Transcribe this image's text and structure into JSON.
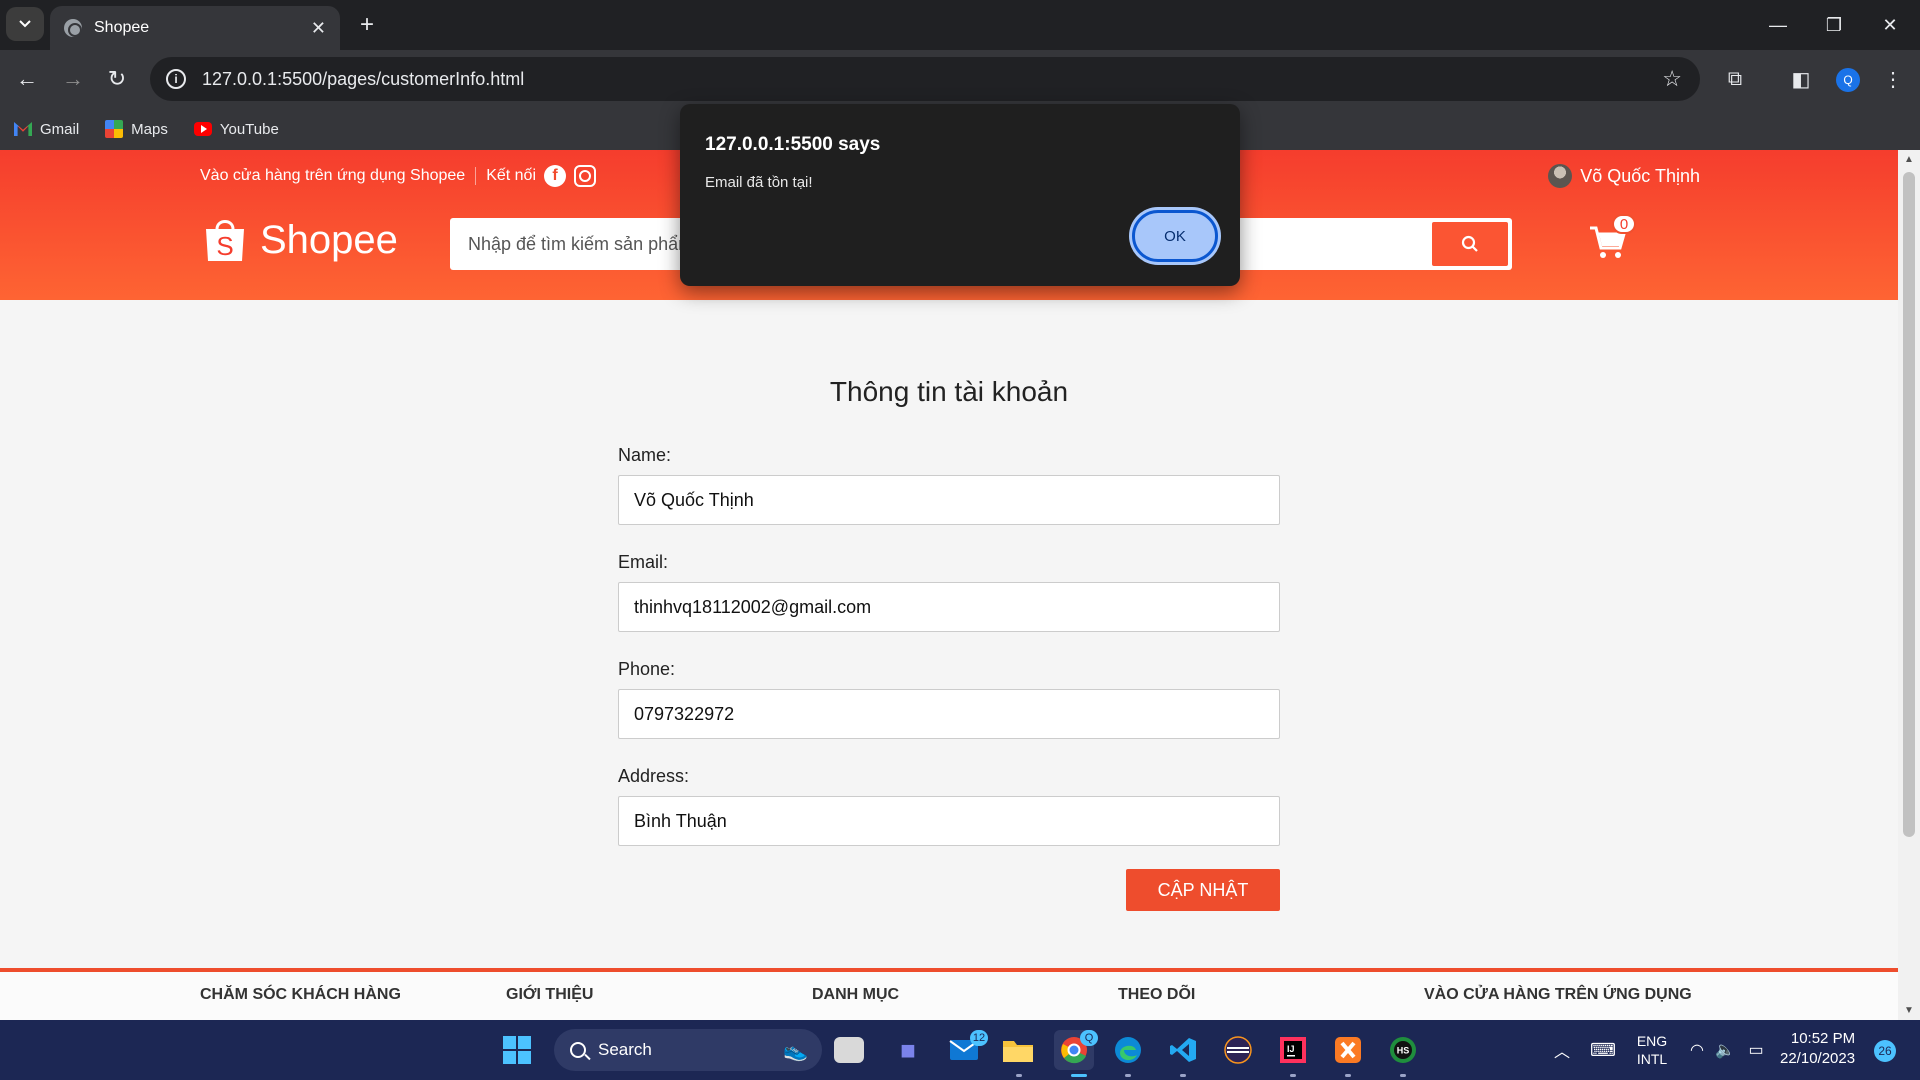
{
  "browser": {
    "tab_title": "Shopee",
    "url": "127.0.0.1:5500/pages/customerInfo.html",
    "profile_initial": "Q",
    "bookmarks": [
      {
        "label": "Gmail",
        "icon": "gmail-icon"
      },
      {
        "label": "Maps",
        "icon": "maps-icon"
      },
      {
        "label": "YouTube",
        "icon": "youtube-icon"
      }
    ]
  },
  "header": {
    "app_download_text": "Vào cửa hàng trên ứng dụng Shopee",
    "connect_text": "Kết nối",
    "user_name": "Võ Quốc Thịnh",
    "logo_text": "Shopee",
    "search_placeholder": "Nhập để tìm kiếm sản phẩm",
    "cart_count": "0"
  },
  "form": {
    "title": "Thông tin tài khoản",
    "name_label": "Name:",
    "name_value": "Võ Quốc Thịnh",
    "email_label": "Email:",
    "email_value": "thinhvq18112002@gmail.com",
    "phone_label": "Phone:",
    "phone_value": "0797322972",
    "address_label": "Address:",
    "address_value": "Bình Thuận",
    "submit_label": "CẬP NHẬT"
  },
  "footer": {
    "columns": [
      "CHĂM SÓC KHÁCH HÀNG",
      "GIỚI THIỆU",
      "DANH MỤC",
      "THEO DÕI",
      "VÀO CỬA HÀNG TRÊN ỨNG DỤNG"
    ]
  },
  "dialog": {
    "title": "127.0.0.1:5500 says",
    "message": "Email đã tồn tại!",
    "ok_label": "OK"
  },
  "taskbar": {
    "search_label": "Search",
    "mail_badge": "12",
    "chrome_badge": "Q",
    "language_1": "ENG",
    "language_2": "INTL",
    "time": "10:52 PM",
    "date": "22/10/2023",
    "notification_count": "26"
  },
  "colors": {
    "brand": "#ee4d2d",
    "header_gradient_top": "#f53d2d",
    "header_gradient_bottom": "#fe6433",
    "dialog_bg": "#1f1f1f",
    "taskbar_bg": "#1c2754"
  }
}
